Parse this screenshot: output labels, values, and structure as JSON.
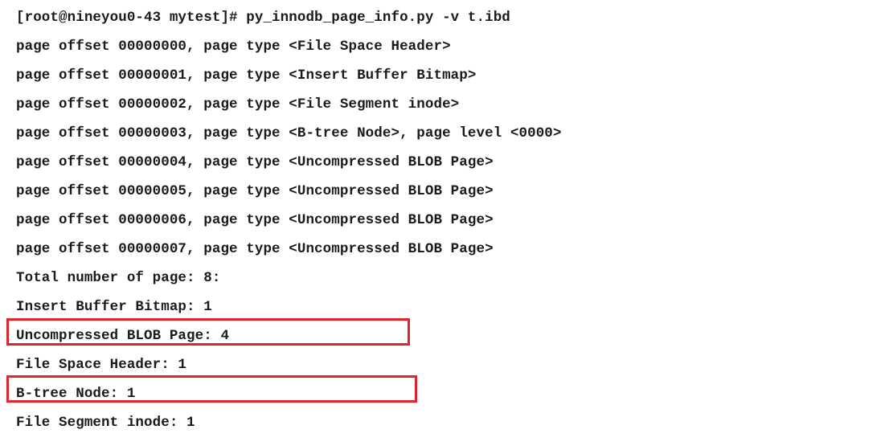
{
  "terminal": {
    "command_line": "[root@nineyou0-43 mytest]# py_innodb_page_info.py -v t.ibd",
    "page_lines": [
      "page offset 00000000, page type <File Space Header>",
      "page offset 00000001, page type <Insert Buffer Bitmap>",
      "page offset 00000002, page type <File Segment inode>",
      "page offset 00000003, page type <B-tree Node>, page level <0000>",
      "page offset 00000004, page type <Uncompressed BLOB Page>",
      "page offset 00000005, page type <Uncompressed BLOB Page>",
      "page offset 00000006, page type <Uncompressed BLOB Page>",
      "page offset 00000007, page type <Uncompressed BLOB Page>"
    ],
    "summary_lines": [
      "Total number of page: 8:",
      "Insert Buffer Bitmap: 1",
      "Uncompressed BLOB Page: 4",
      "File Space Header: 1",
      "B-tree Node: 1",
      "File Segment inode: 1"
    ]
  },
  "highlight_color": "#e0262b"
}
